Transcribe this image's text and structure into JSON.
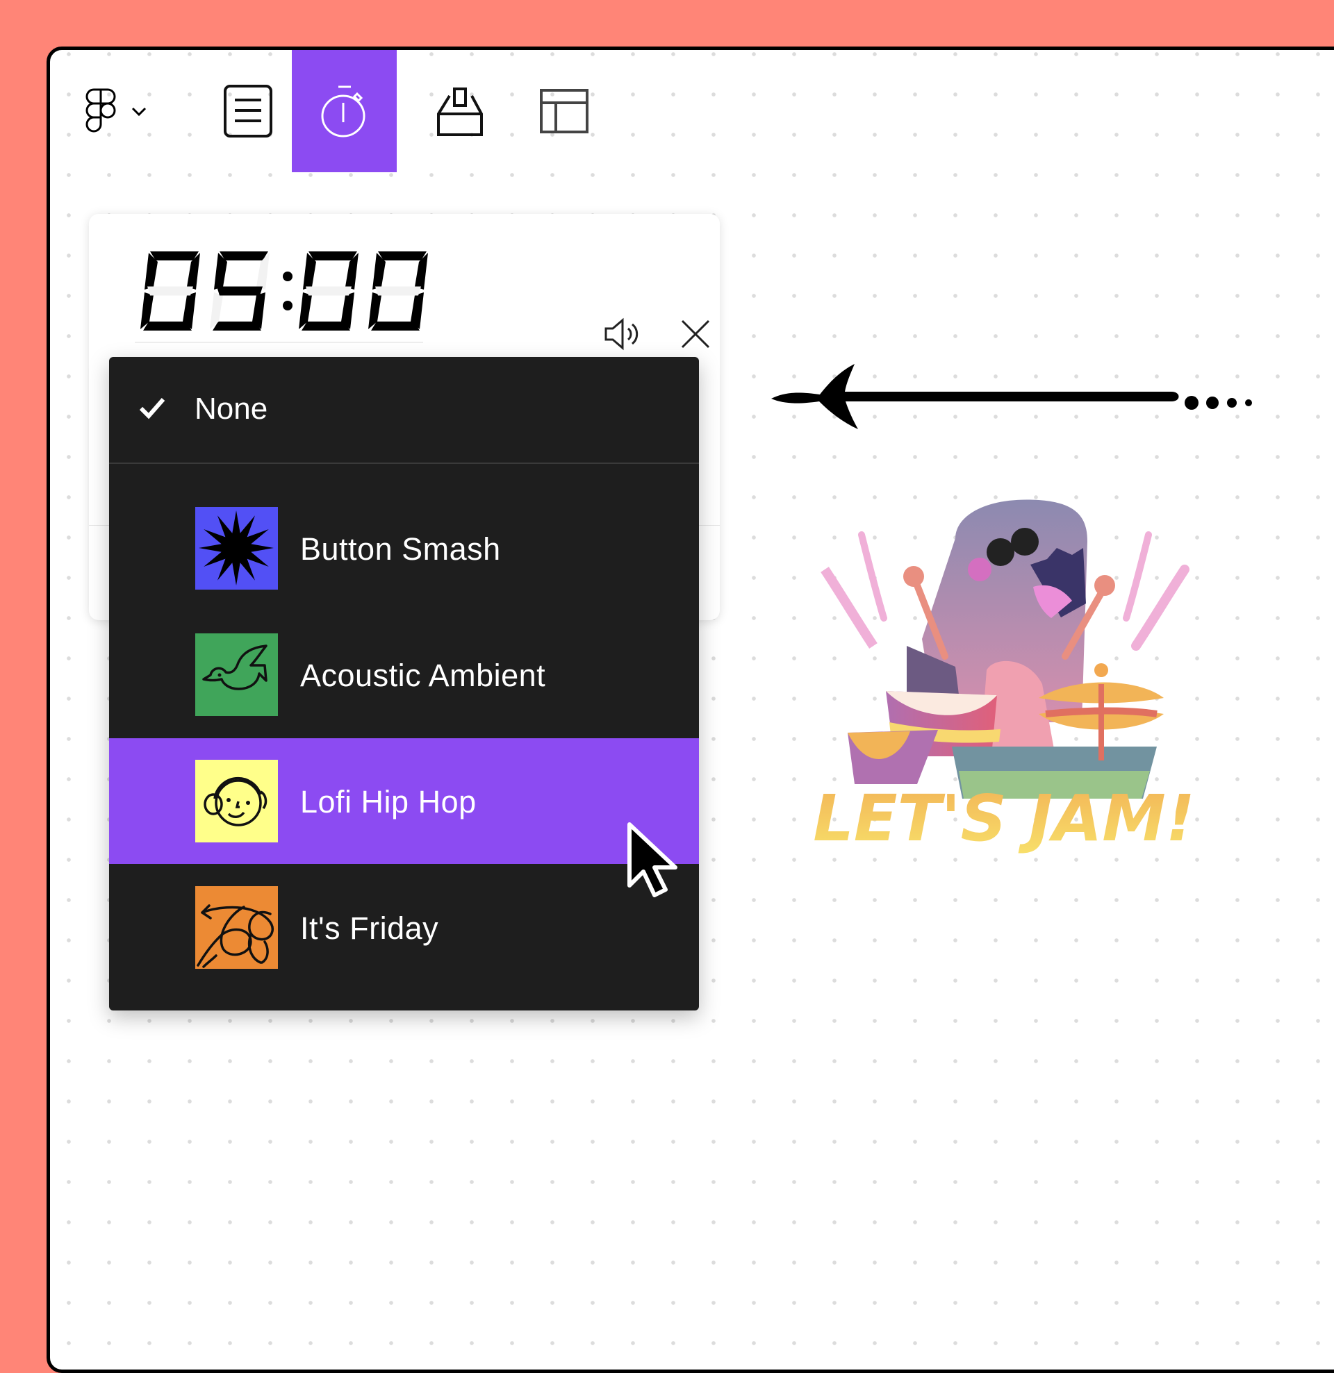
{
  "toolbar": {
    "items": [
      {
        "icon": "figma-logo-icon",
        "has_dropdown": true,
        "active": false
      },
      {
        "icon": "document-list-icon",
        "active": false
      },
      {
        "icon": "stopwatch-timer-icon",
        "active": true
      },
      {
        "icon": "ballot-box-icon",
        "active": false
      },
      {
        "icon": "layout-template-icon",
        "active": false
      }
    ],
    "accent_color": "#8C4BF2"
  },
  "timer": {
    "display": "05:00",
    "minutes": "05",
    "seconds": "00",
    "volume_icon": "speaker-volume-icon",
    "close_icon": "close-icon"
  },
  "music_menu": {
    "selected": "None",
    "hovered": "Lofi Hip Hop",
    "none_label": "None",
    "items": [
      {
        "label": "Button Smash",
        "thumb_color": "#5250F5",
        "thumb_icon": "starburst-icon"
      },
      {
        "label": "Acoustic Ambient",
        "thumb_color": "#40A55A",
        "thumb_icon": "bird-icon"
      },
      {
        "label": "Lofi Hip Hop",
        "thumb_color": "#FFFF8A",
        "thumb_icon": "headphones-face-icon"
      },
      {
        "label": "It's Friday",
        "thumb_color": "#EC8A34",
        "thumb_icon": "scribble-arrow-icon"
      }
    ]
  },
  "canvas": {
    "sticker_text": "LET'S JAM!",
    "background_color": "#FF8577"
  }
}
